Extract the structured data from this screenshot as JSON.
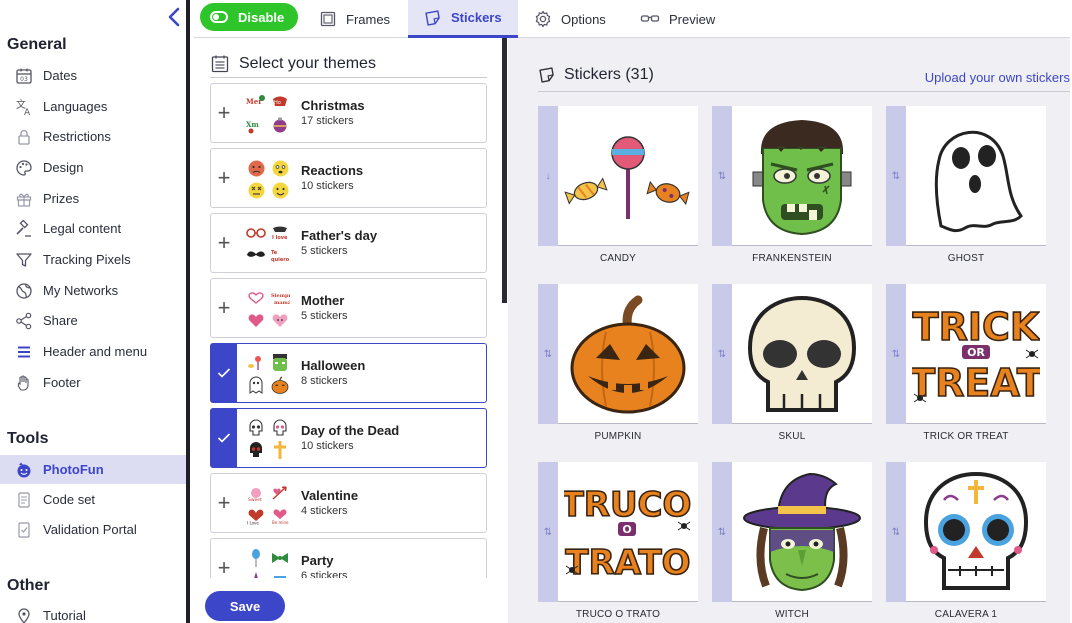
{
  "sidebar": {
    "sections": [
      {
        "title": "General"
      },
      {
        "title": "Tools"
      },
      {
        "title": "Other"
      }
    ],
    "general_items": [
      {
        "label": "Dates",
        "icon": "calendar-icon"
      },
      {
        "label": "Languages",
        "icon": "translate-icon"
      },
      {
        "label": "Restrictions",
        "icon": "lock-icon"
      },
      {
        "label": "Design",
        "icon": "palette-icon"
      },
      {
        "label": "Prizes",
        "icon": "gift-icon"
      },
      {
        "label": "Legal content",
        "icon": "gavel-icon"
      },
      {
        "label": "Tracking Pixels",
        "icon": "filter-icon"
      },
      {
        "label": "My Networks",
        "icon": "globe-icon"
      },
      {
        "label": "Share",
        "icon": "share-icon"
      },
      {
        "label": "Header and menu",
        "icon": "menu-icon"
      },
      {
        "label": "Footer",
        "icon": "hand-icon"
      }
    ],
    "tools_items": [
      {
        "label": "PhotoFun",
        "icon": "photofun-icon",
        "active": true
      },
      {
        "label": "Code set",
        "icon": "code-icon"
      },
      {
        "label": "Validation Portal",
        "icon": "portal-icon"
      }
    ],
    "other_items": [
      {
        "label": "Tutorial",
        "icon": "location-icon"
      }
    ]
  },
  "topbar": {
    "toggle_label": "Disable",
    "tabs": [
      {
        "label": "Frames",
        "icon": "frame-icon"
      },
      {
        "label": "Stickers",
        "icon": "sticker-icon",
        "active": true
      },
      {
        "label": "Options",
        "icon": "gear-icon"
      },
      {
        "label": "Preview",
        "icon": "glasses-icon"
      }
    ]
  },
  "themes": {
    "header": "Select your themes",
    "items": [
      {
        "name": "Christmas",
        "count": "17 stickers",
        "selected": false
      },
      {
        "name": "Reactions",
        "count": "10 stickers",
        "selected": false
      },
      {
        "name": "Father's day",
        "count": "5 stickers",
        "selected": false
      },
      {
        "name": "Mother",
        "count": "5 stickers",
        "selected": false
      },
      {
        "name": "Halloween",
        "count": "8 stickers",
        "selected": true
      },
      {
        "name": "Day of the Dead",
        "count": "10 stickers",
        "selected": true
      },
      {
        "name": "Valentine",
        "count": "4 stickers",
        "selected": false
      },
      {
        "name": "Party",
        "count": "6 stickers",
        "selected": false
      }
    ],
    "save_label": "Save"
  },
  "stickers": {
    "title": "Stickers (31)",
    "upload_label": "Upload your own stickers",
    "items": [
      {
        "label": "CANDY",
        "handle": "↓"
      },
      {
        "label": "FRANKENSTEIN",
        "handle": "⇅"
      },
      {
        "label": "GHOST",
        "handle": "⇅"
      },
      {
        "label": "PUMPKIN",
        "handle": "⇅"
      },
      {
        "label": "SKUL",
        "handle": "⇅"
      },
      {
        "label": "TRICK OR TREAT",
        "handle": "⇅"
      },
      {
        "label": "TRUCO O TRATO",
        "handle": "⇅"
      },
      {
        "label": "WITCH",
        "handle": "⇅"
      },
      {
        "label": "CALAVERA 1",
        "handle": "⇅"
      }
    ],
    "art_text": {
      "trick_top": "TRICK",
      "trick_mid": "OR",
      "trick_bot": "TREAT",
      "truco_top": "TRUCO",
      "truco_mid": "O",
      "truco_bot": "TRATO"
    }
  },
  "colors": {
    "accent": "#3c46c8",
    "toggle_green": "#2ec52b",
    "active_bg": "#dcdcf3"
  }
}
